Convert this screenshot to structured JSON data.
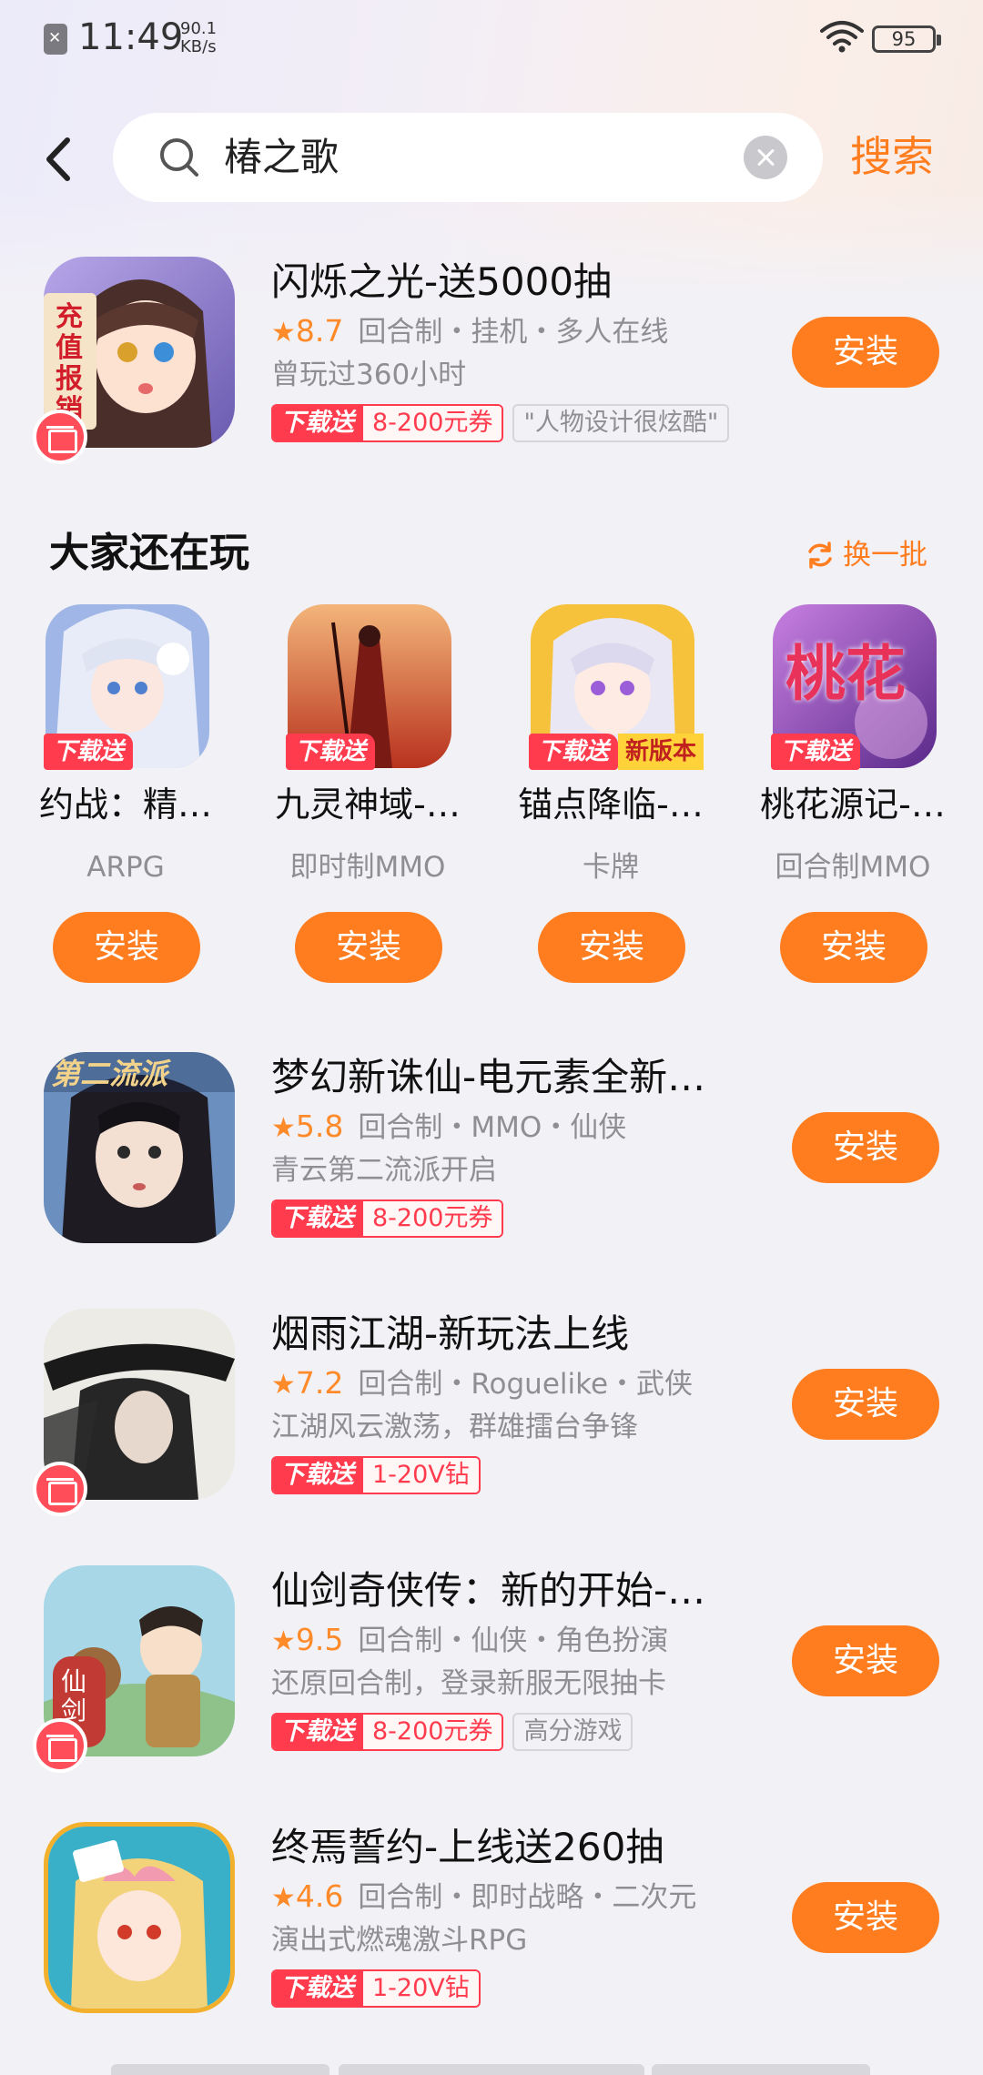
{
  "status_bar": {
    "time": "11:49",
    "speed_value": "90.1",
    "speed_unit": "KB/s",
    "battery": "95",
    "icons": [
      "sim-off-icon",
      "wifi-icon",
      "battery-icon"
    ]
  },
  "search": {
    "query": "椿之歌",
    "submit_label": "搜索",
    "icons": [
      "back-arrow-icon",
      "search-icon",
      "clear-icon"
    ]
  },
  "top_result": {
    "name": "闪烁之光-送5000抽",
    "rating": "8.7",
    "meta": "回合制・挂机・多人在线",
    "desc": "曾玩过360小时",
    "promo_label": "下载送",
    "promo_value": "8-200元券",
    "extra_tag": "\"人物设计很炫酷\"",
    "icon_text": "充值报销",
    "install_label": "安装"
  },
  "section": {
    "title": "大家还在玩",
    "refresh_label": "换一批",
    "items": [
      {
        "name": "约战：精…",
        "category": "ARPG",
        "tag": "下载送",
        "install_label": "安装"
      },
      {
        "name": "九灵神域-…",
        "category": "即时制MMO",
        "tag": "下载送",
        "install_label": "安装"
      },
      {
        "name": "锚点降临-…",
        "category": "卡牌",
        "tag": "下载送",
        "tag2": "新版本",
        "install_label": "安装"
      },
      {
        "name": "桃花源记-…",
        "category": "回合制MMO",
        "tag": "下载送",
        "icon_text": "桃花",
        "install_label": "安装"
      }
    ]
  },
  "results": [
    {
      "name": "梦幻新诛仙-电元素全新…",
      "rating": "5.8",
      "meta": "回合制・MMO・仙侠",
      "desc": "青云第二流派开启",
      "promo_label": "下载送",
      "promo_value": "8-200元券",
      "icon_text": "第二流派",
      "install_label": "安装"
    },
    {
      "name": "烟雨江湖-新玩法上线",
      "rating": "7.2",
      "meta": "回合制・Roguelike・武侠",
      "desc": "江湖风云激荡，群雄擂台争锋",
      "promo_label": "下载送",
      "promo_value": "1-20V钻",
      "install_label": "安装"
    },
    {
      "name": "仙剑奇侠传：新的开始-…",
      "rating": "9.5",
      "meta": "回合制・仙侠・角色扮演",
      "desc": "还原回合制，登录新服无限抽卡",
      "promo_label": "下载送",
      "promo_value": "8-200元券",
      "extra_tag": "高分游戏",
      "icon_text": "仙剑",
      "install_label": "安装"
    },
    {
      "name": "终焉誓约-上线送260抽",
      "rating": "4.6",
      "meta": "回合制・即时战略・二次元",
      "desc": "演出式燃魂激斗RPG",
      "promo_label": "下载送",
      "promo_value": "1-20V钻",
      "install_label": "安装"
    }
  ],
  "colors": {
    "accent": "#ff7d1f",
    "promo": "#ff3b4d",
    "background": "#f2f1f6",
    "secondary_text": "#8e8e93"
  }
}
